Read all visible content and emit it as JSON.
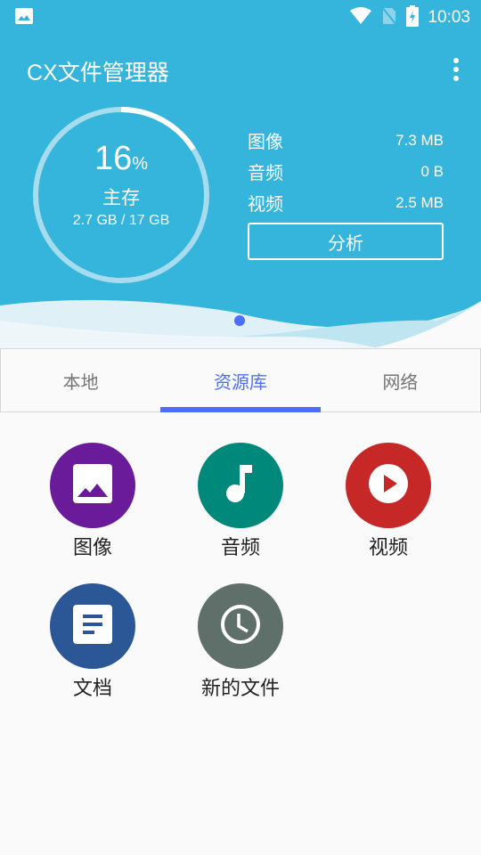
{
  "status_bar": {
    "left_icon": "image-notification-icon",
    "icons": [
      "wifi-icon",
      "no-sim-icon",
      "battery-charging-icon"
    ],
    "time": "10:03"
  },
  "app": {
    "title": "CX文件管理器",
    "menu_icon": "more-vert-icon"
  },
  "storage": {
    "percent": "16",
    "percent_sign": "%",
    "used_fraction": 0.16,
    "label": "主存",
    "size": "2.7 GB / 17 GB"
  },
  "stats": [
    {
      "label": "图像",
      "value": "7.3 MB"
    },
    {
      "label": "音频",
      "value": "0 B"
    },
    {
      "label": "视频",
      "value": "2.5 MB"
    }
  ],
  "analyze_button": "分析",
  "tabs": [
    {
      "label": "本地",
      "active": false
    },
    {
      "label": "资源库",
      "active": true
    },
    {
      "label": "网络",
      "active": false
    }
  ],
  "categories": [
    {
      "label": "图像",
      "icon": "image-icon",
      "color": "#6a1b9a"
    },
    {
      "label": "音频",
      "icon": "music-note-icon",
      "color": "#00897b"
    },
    {
      "label": "视频",
      "icon": "play-circle-icon",
      "color": "#c62828"
    },
    {
      "label": "文档",
      "icon": "document-icon",
      "color": "#2b5797"
    },
    {
      "label": "新的文件",
      "icon": "clock-icon",
      "color": "#5f6f6a"
    }
  ],
  "colors": {
    "header": "#35b5db",
    "accent": "#4f6ef7"
  }
}
